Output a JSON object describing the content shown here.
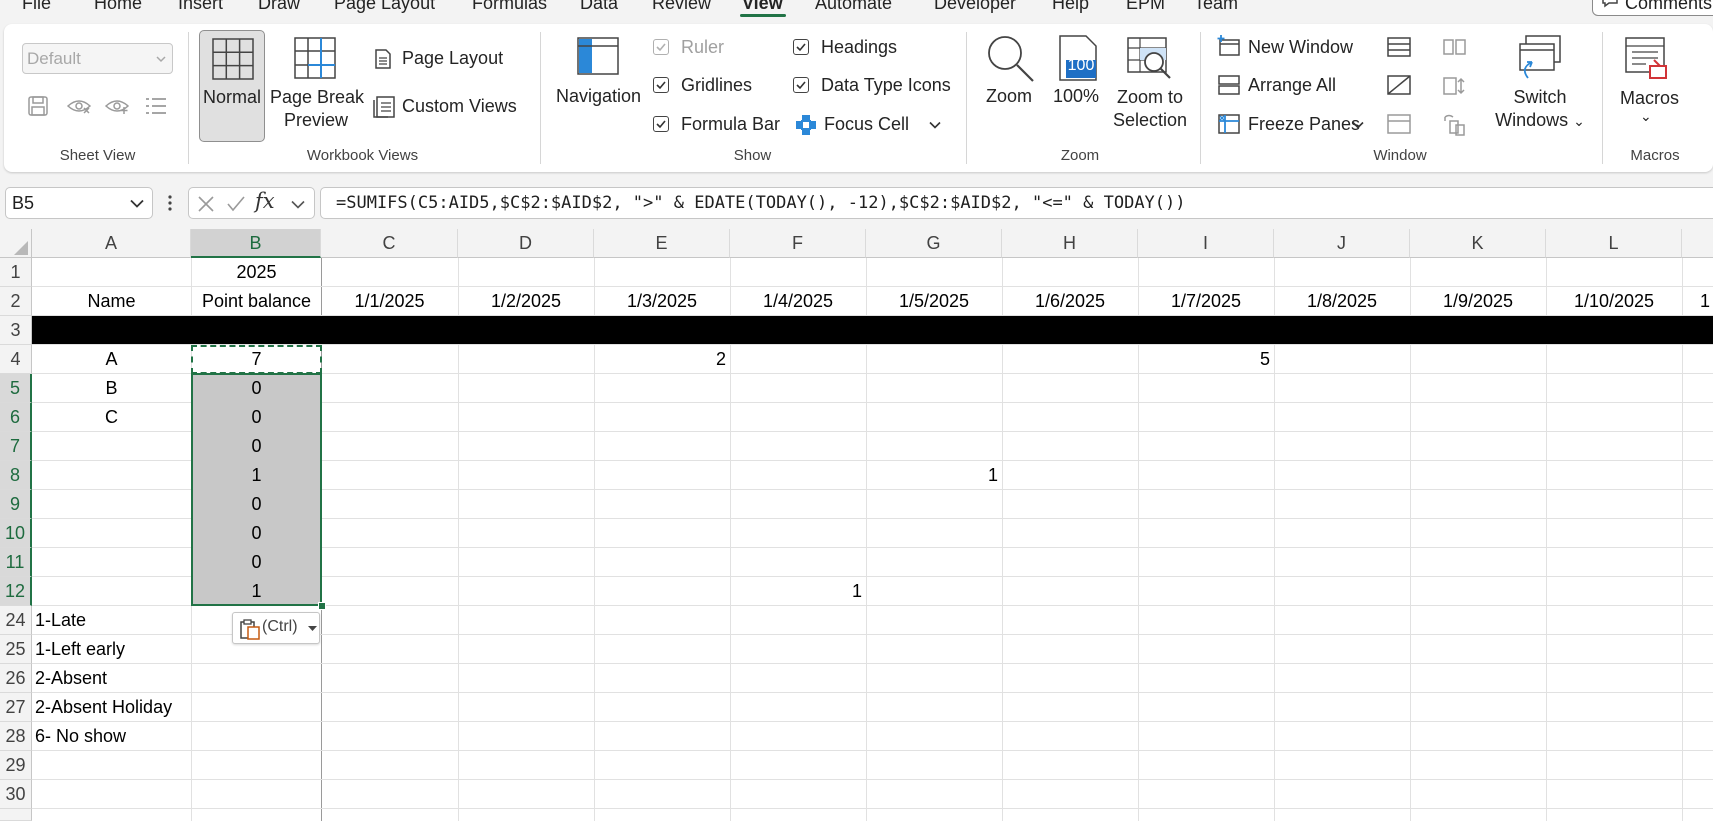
{
  "menu": {
    "tabs": [
      "File",
      "Home",
      "Insert",
      "Draw",
      "Page Layout",
      "Formulas",
      "Data",
      "Review",
      "View",
      "Automate",
      "Developer",
      "Help",
      "EPM",
      "Team"
    ],
    "active": "View",
    "comments_label": "Comments"
  },
  "ribbon": {
    "sheet_view": {
      "dropdown_value": "Default",
      "group_label": "Sheet View"
    },
    "workbook_views": {
      "normal": "Normal",
      "page_break_line1": "Page Break",
      "page_break_line2": "Preview",
      "page_layout": "Page Layout",
      "custom_views": "Custom Views",
      "group_label": "Workbook Views"
    },
    "show": {
      "navigation": "Navigation",
      "ruler": "Ruler",
      "gridlines": "Gridlines",
      "formula_bar": "Formula Bar",
      "headings": "Headings",
      "data_type_icons": "Data Type Icons",
      "focus_cell": "Focus Cell",
      "group_label": "Show"
    },
    "zoom": {
      "zoom": "Zoom",
      "hundred": "100%",
      "hundred_badge": "100",
      "zoom_to_line1": "Zoom to",
      "zoom_to_line2": "Selection",
      "group_label": "Zoom"
    },
    "window": {
      "new_window": "New Window",
      "arrange_all": "Arrange All",
      "freeze_panes": "Freeze Panes",
      "switch_line1": "Switch",
      "switch_line2": "Windows",
      "group_label": "Window"
    },
    "macros": {
      "macros": "Macros",
      "group_label": "Macros"
    }
  },
  "formula_bar": {
    "name_box": "B5",
    "formula": "=SUMIFS(C5:AID5,$C$2:$AID$2, \">\" & EDATE(TODAY(), -12),$C$2:$AID$2, \"<=\" & TODAY())"
  },
  "grid": {
    "columns": [
      "A",
      "B",
      "C",
      "D",
      "E",
      "F",
      "G",
      "H",
      "I",
      "J",
      "K",
      "L"
    ],
    "rows": [
      "1",
      "2",
      "3",
      "4",
      "5",
      "6",
      "7",
      "8",
      "9",
      "10",
      "11",
      "12",
      "24",
      "25",
      "26",
      "27",
      "28",
      "29",
      "30"
    ],
    "cells": {
      "B1": "2025",
      "A2": "Name",
      "B2": "Point balance",
      "C2": "1/1/2025",
      "D2": "1/2/2025",
      "E2": "1/3/2025",
      "F2": "1/4/2025",
      "G2": "1/5/2025",
      "H2": "1/6/2025",
      "I2": "1/7/2025",
      "J2": "1/8/2025",
      "K2": "1/9/2025",
      "L2": "1/10/2025",
      "M2": "1",
      "A4": "A",
      "A5": "B",
      "A6": "C",
      "B4": "7",
      "B5": "0",
      "B6": "0",
      "B7": "0",
      "B8": "1",
      "B9": "0",
      "B10": "0",
      "B11": "0",
      "B12": "1",
      "E4": "2",
      "I4": "5",
      "G8": "1",
      "F12": "1",
      "A24": "1-Late",
      "A25": "1-Left early",
      "A26": "2-Absent",
      "A27": "2-Absent Holiday",
      "A28": "6- No show"
    },
    "paste_options_label": "(Ctrl)"
  },
  "colors": {
    "accent": "#217346",
    "selection_fill": "#c8c8c8",
    "black_band": "#000000"
  }
}
